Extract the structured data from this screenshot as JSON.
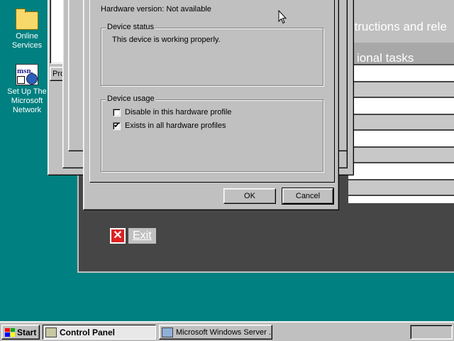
{
  "desktop": {
    "icons": [
      {
        "label": "Online Services",
        "icon": "folder-icon"
      },
      {
        "label": "Set Up The Microsoft Network",
        "icon": "msn-icon",
        "glyph_text": "msn."
      }
    ]
  },
  "background_app": {
    "heading_1": "structions and rele",
    "heading_2": "ional tasks",
    "exit_label": "Exit"
  },
  "behind_window": {
    "partial_button": "Pro"
  },
  "dialog": {
    "hardware_version": "Hardware version: Not available",
    "device_status": {
      "title": "Device status",
      "text": "This device is working properly."
    },
    "device_usage": {
      "title": "Device usage",
      "options": [
        {
          "label": "Disable in this hardware profile",
          "checked": false
        },
        {
          "label": "Exists in all hardware profiles",
          "checked": true
        }
      ]
    },
    "ok_label": "OK",
    "cancel_label": "Cancel"
  },
  "taskbar": {
    "start_label": "Start",
    "tasks": [
      {
        "label": "Control Panel",
        "active": true
      },
      {
        "label": "Microsoft Windows Server ...",
        "active": false
      }
    ]
  },
  "colors": {
    "desktop": "#008080",
    "face": "#c0c0c0",
    "dark_app": "#464646",
    "exit_red": "#dd2222"
  }
}
